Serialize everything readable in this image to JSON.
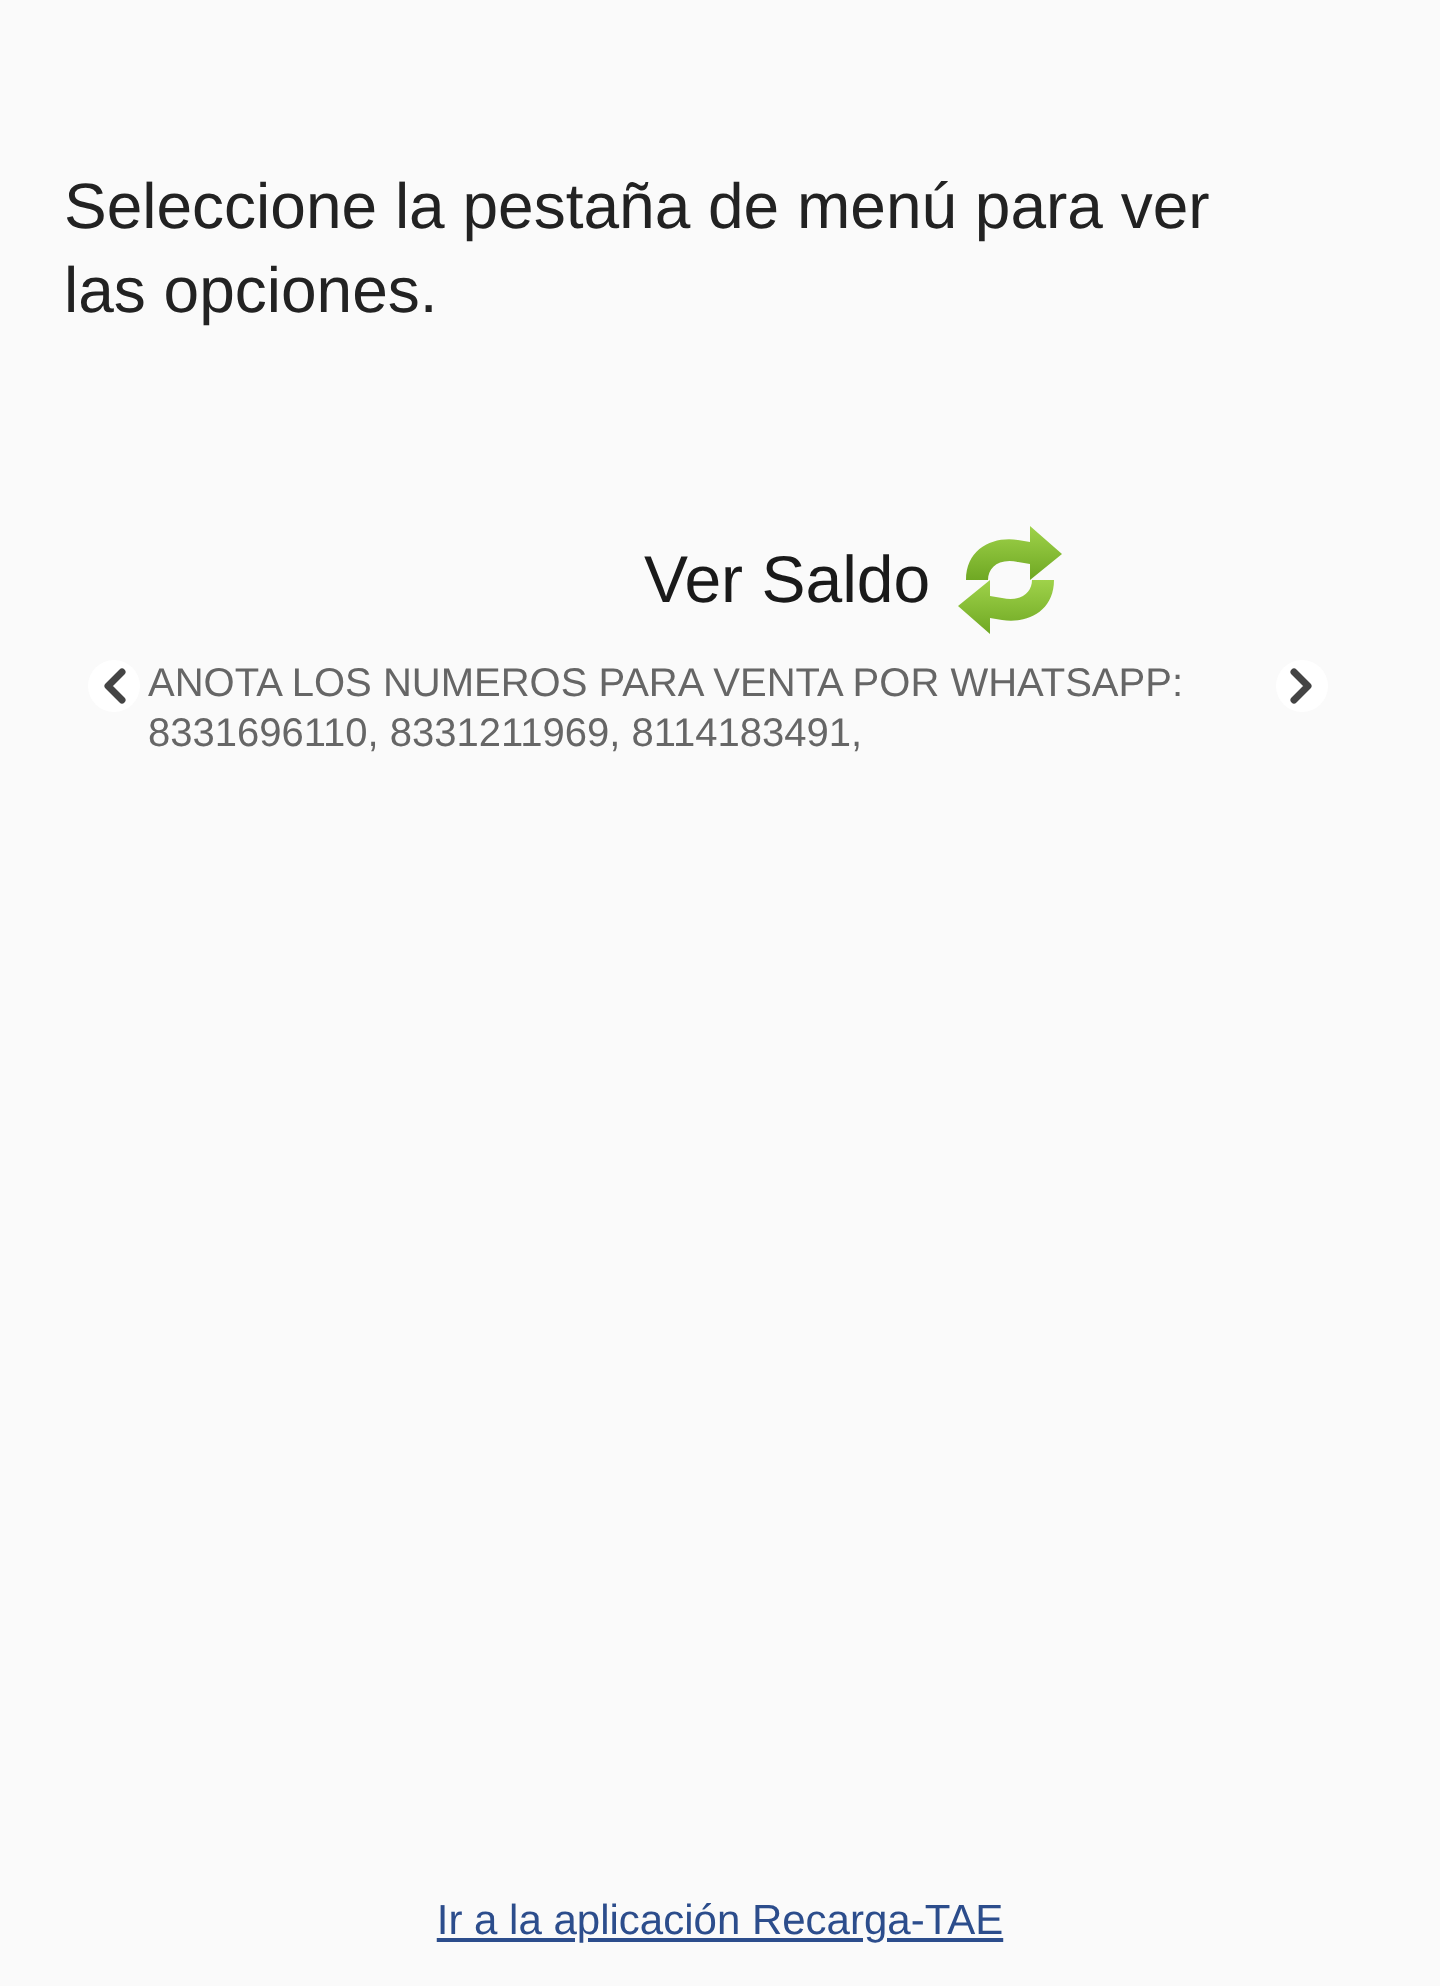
{
  "instructions": "Seleccione la pestaña de menú para ver las opciones.",
  "balance": {
    "label": "Ver Saldo"
  },
  "ticker": {
    "text": "ANOTA LOS NUMEROS PARA VENTA POR WHATSAPP: 8331696110, 8331211969, 8114183491,"
  },
  "footer_link": "Ir a la aplicación Recarga-TAE"
}
